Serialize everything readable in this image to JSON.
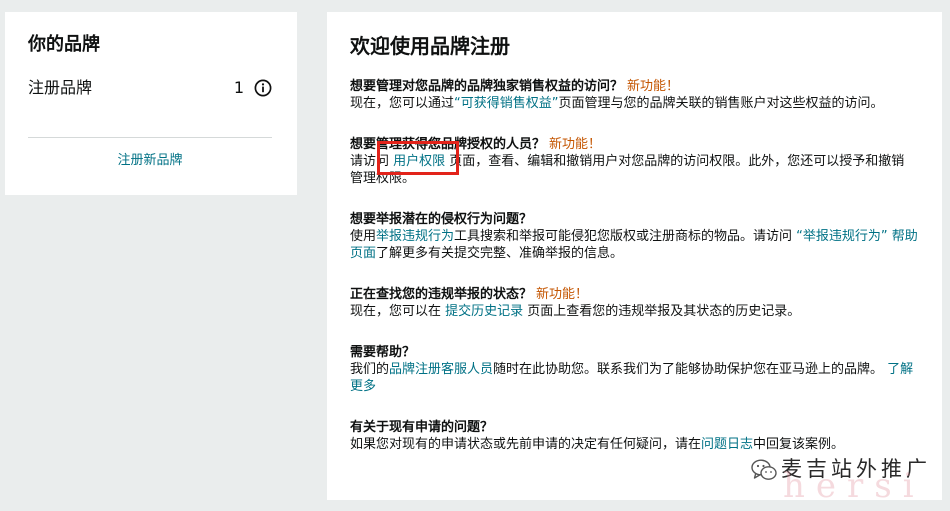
{
  "theme": {
    "page_bg": "#eaeded",
    "text": "#0f1111",
    "link": "#007185",
    "badge": "#c45500",
    "highlight": "#e2231a"
  },
  "brand_card": {
    "title": "你的品牌",
    "registered_label": "注册品牌",
    "registered_count": "1",
    "info_icon": "info-icon",
    "register_new_link": "注册新品牌"
  },
  "main": {
    "title": "欢迎使用品牌注册",
    "sections": [
      {
        "heading": "想要管理对您品牌的品牌独家销售权益的访问？",
        "badge": "新功能！",
        "lines": [
          [
            "现在，您可以通过",
            "“可获得销售权益”",
            "页面管理与您的品牌关联的销售账户对这些权益的访问。"
          ]
        ]
      },
      {
        "heading": "想要管理获得您品牌授权的人员？",
        "badge": "新功能！",
        "lines": [
          [
            "请访问 ",
            "用户权限",
            " 页面，查看、编辑和撤销用户对您品牌的访问权限。此外，您还可以授予和撤销"
          ],
          [
            "管理权限。"
          ]
        ]
      },
      {
        "heading": "想要举报潜在的侵权行为问题？",
        "lines": [
          [
            "使用",
            "举报违规行为",
            "工具搜索和举报可能侵犯您版权或注册商标的物品。请访问 ",
            "“举报违规行为” 帮助"
          ],
          [
            "页面",
            "了解更多有关提交完整、准确举报的信息。"
          ]
        ]
      },
      {
        "heading": "正在查找您的违规举报的状态？",
        "badge": "新功能！",
        "lines": [
          [
            "现在，您可以在 ",
            "提交历史记录",
            " 页面上查看您的违规举报及其状态的历史记录。"
          ]
        ]
      },
      {
        "heading": "需要帮助？",
        "lines": [
          [
            "我们的",
            "品牌注册客服人员",
            "随时在此协助您。联系我们为了能够协助保护您在亚马逊上的品牌。 ",
            "了解"
          ],
          [
            "更多"
          ]
        ]
      },
      {
        "heading": "有关于现有申请的问题？",
        "lines": [
          [
            "如果您对现有的申请状态或先前申请的决定有任何疑问，请在",
            "问题日志",
            "中回复该案例。"
          ]
        ]
      }
    ]
  },
  "watermark": {
    "icon": "wechat-icon",
    "account": "麦吉站外推广",
    "overlay_text": "hersi"
  }
}
